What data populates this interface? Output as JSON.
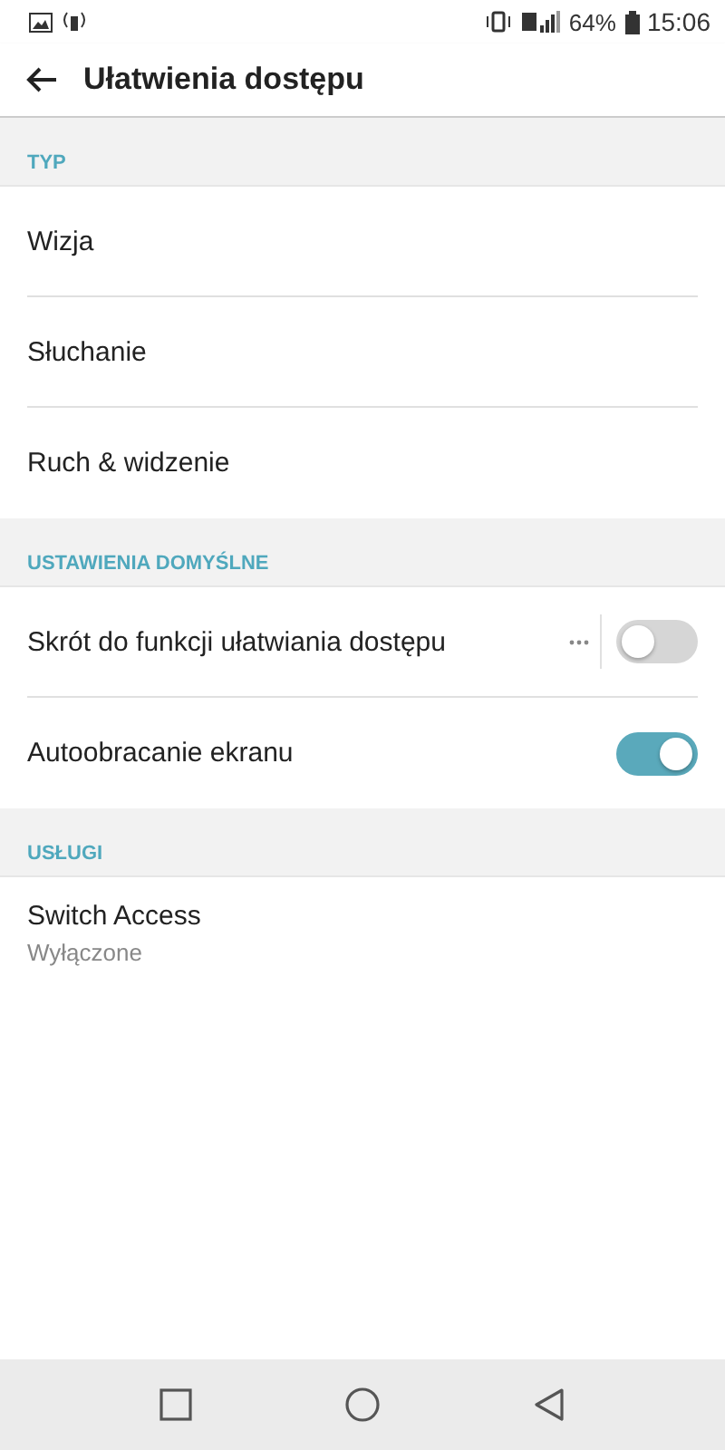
{
  "status_bar": {
    "battery": "64%",
    "time": "15:06"
  },
  "app_bar": {
    "title": "Ułatwienia dostępu"
  },
  "sections": [
    {
      "header": "TYP",
      "items": [
        {
          "kind": "plain",
          "label": "Wizja"
        },
        {
          "kind": "plain",
          "label": "Słuchanie"
        },
        {
          "kind": "plain",
          "label": "Ruch & widzenie"
        }
      ]
    },
    {
      "header": "USTAWIENIA DOMYŚLNE",
      "items": [
        {
          "kind": "toggle",
          "label": "Skrót do funkcji ułatwiania dostępu",
          "more": true,
          "on": false
        },
        {
          "kind": "toggle",
          "label": "Autoobracanie ekranu",
          "more": false,
          "on": true
        }
      ]
    },
    {
      "header": "USŁUGI",
      "items": [
        {
          "kind": "subtitle",
          "label": "Switch Access",
          "subtitle": "Wyłączone"
        }
      ]
    }
  ]
}
